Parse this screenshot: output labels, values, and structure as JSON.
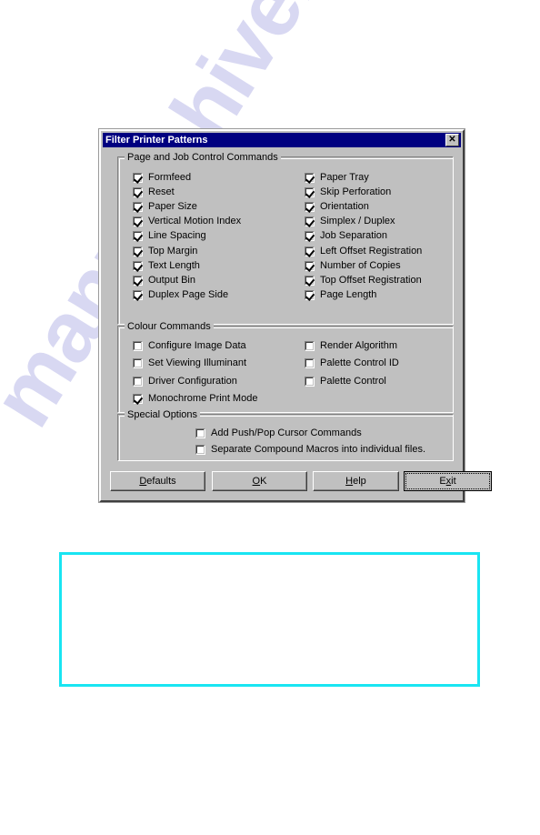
{
  "page": {
    "watermark_text": "manualshive.com",
    "background_color": "#ffffff"
  },
  "dialog": {
    "title": "Filter Printer Patterns",
    "close_icon": "close-icon",
    "close_label": "✕",
    "titlebar_color": "#000080",
    "face_color": "#c0c0c0",
    "groups": [
      {
        "id": "page-job-control",
        "label": "Page and Job Control Commands",
        "left_column": [
          {
            "label": "Formfeed",
            "checked": true
          },
          {
            "label": "Reset",
            "checked": true
          },
          {
            "label": "Paper Size",
            "checked": true
          },
          {
            "label": "Vertical Motion Index",
            "checked": true
          },
          {
            "label": "Line Spacing",
            "checked": true
          },
          {
            "label": "Top Margin",
            "checked": true
          },
          {
            "label": "Text Length",
            "checked": true
          },
          {
            "label": "Output Bin",
            "checked": true
          },
          {
            "label": "Duplex Page Side",
            "checked": true
          }
        ],
        "right_column": [
          {
            "label": "Paper Tray",
            "checked": true
          },
          {
            "label": "Skip Perforation",
            "checked": true
          },
          {
            "label": "Orientation",
            "checked": true
          },
          {
            "label": "Simplex  /  Duplex",
            "checked": true
          },
          {
            "label": "Job Separation",
            "checked": true
          },
          {
            "label": "Left Offset Registration",
            "checked": true
          },
          {
            "label": "Number of Copies",
            "checked": true
          },
          {
            "label": "Top Offset Registration",
            "checked": true
          },
          {
            "label": "Page Length",
            "checked": true
          }
        ]
      },
      {
        "id": "colour-commands",
        "label": "Colour Commands",
        "left_column": [
          {
            "label": "Configure Image Data",
            "checked": false
          },
          {
            "label": "Set Viewing Illuminant",
            "checked": false
          },
          {
            "label": "Driver Configuration",
            "checked": false
          },
          {
            "label": "Monochrome Print Mode",
            "checked": true
          }
        ],
        "right_column": [
          {
            "label": "Render Algorithm",
            "checked": false
          },
          {
            "label": "Palette Control ID",
            "checked": false
          },
          {
            "label": "Palette Control",
            "checked": false
          }
        ]
      },
      {
        "id": "special-options",
        "label": "Special Options",
        "options": [
          {
            "label": "Add Push/Pop Cursor Commands",
            "checked": false
          },
          {
            "label": "Separate Compound Macros into individual files.",
            "checked": false
          }
        ]
      }
    ],
    "buttons": [
      {
        "id": "defaults",
        "label": "Defaults",
        "accel": "D",
        "default": false
      },
      {
        "id": "ok",
        "label": "OK",
        "accel": "O",
        "default": false
      },
      {
        "id": "help",
        "label": "Help",
        "accel": "H",
        "default": false
      },
      {
        "id": "exit",
        "label": "Exit",
        "accel": "x",
        "default": true
      }
    ]
  },
  "callout": {
    "border_color": "#19e5f2",
    "content": ""
  }
}
